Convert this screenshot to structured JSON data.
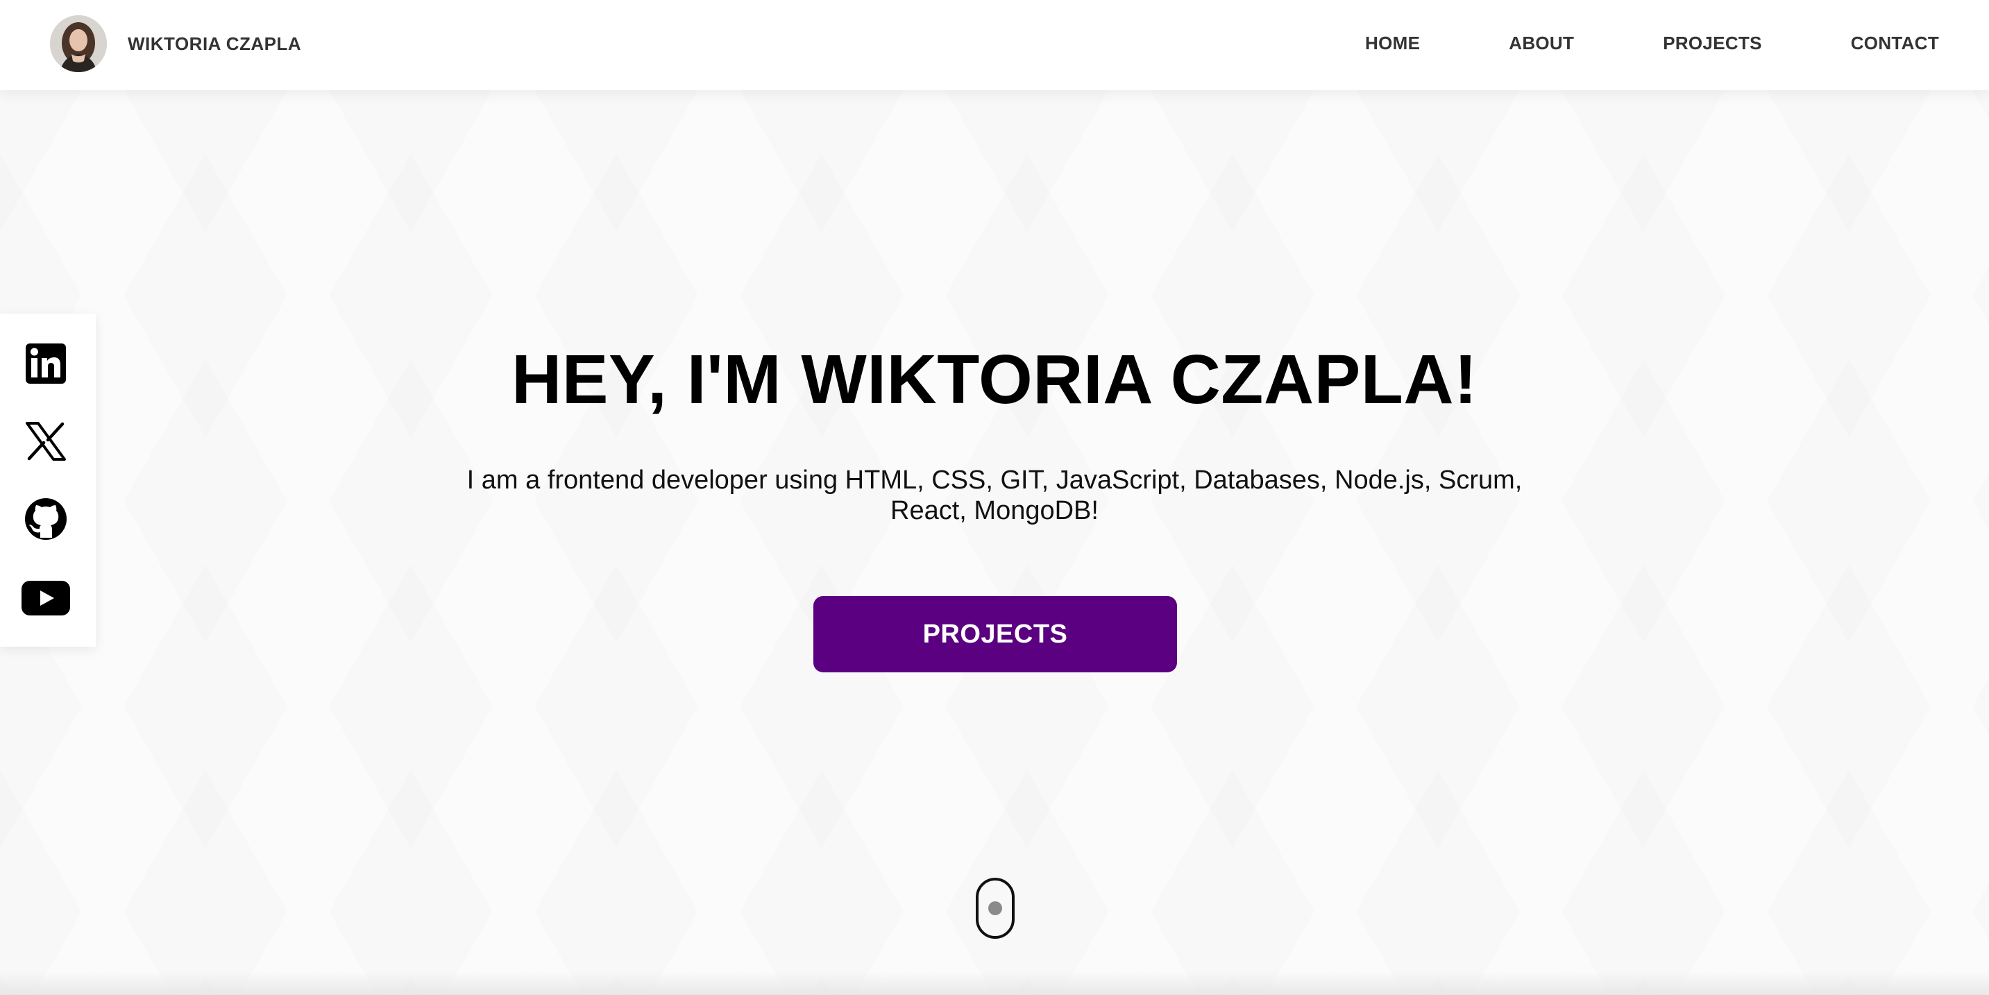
{
  "header": {
    "brand_name": "WIKTORIA CZAPLA",
    "nav": [
      {
        "label": "HOME"
      },
      {
        "label": "ABOUT"
      },
      {
        "label": "PROJECTS"
      },
      {
        "label": "CONTACT"
      }
    ]
  },
  "social": [
    {
      "icon": "linkedin-icon"
    },
    {
      "icon": "x-icon"
    },
    {
      "icon": "github-icon"
    },
    {
      "icon": "youtube-icon"
    }
  ],
  "hero": {
    "title": "HEY, I'M WIKTORIA CZAPLA!",
    "description": "I am a frontend developer using HTML, CSS, GIT, JavaScript, Databases, Node.js, Scrum, React, MongoDB!",
    "cta_label": "PROJECTS"
  },
  "colors": {
    "accent": "#5a0080",
    "text": "#000000",
    "nav_text": "#333333"
  }
}
